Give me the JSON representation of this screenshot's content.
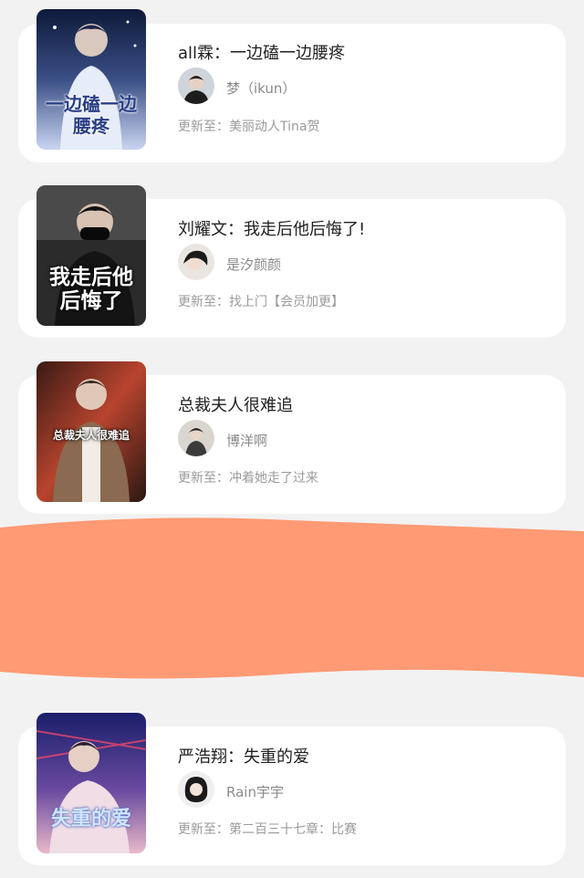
{
  "colors": {
    "background": "#f2f2f2",
    "card": "#ffffff",
    "title_text": "#1f1f1f",
    "meta_text": "#9a9a9a",
    "redaction": "#ff9a74"
  },
  "books": [
    {
      "title": "all霖：一边磕一边腰疼",
      "cover_text": "一边磕一边腰疼",
      "author": "梦（ikun）",
      "update_prefix": "更新至：",
      "update": "美丽动人Tina贺"
    },
    {
      "title": "刘耀文：我走后他后悔了!",
      "cover_text": "我走后他后悔了",
      "author": "是汐颜颜",
      "update_prefix": "更新至：",
      "update": "找上门【会员加更】"
    },
    {
      "title": "总裁夫人很难追",
      "cover_text": "总裁夫人很难追",
      "author": "博洋啊",
      "update_prefix": "更新至：",
      "update": "冲着她走了过来"
    },
    {
      "title": "严浩翔：失重的爱",
      "cover_text": "失重的爱",
      "author": "Rain宇宇",
      "update_prefix": "更新至：",
      "update": "第二百三十七章：比赛"
    }
  ]
}
